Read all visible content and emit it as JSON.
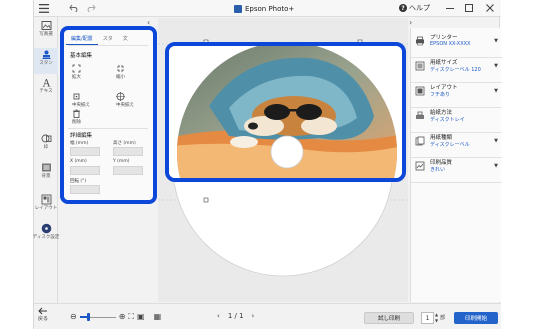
{
  "titlebar": {
    "title": "Epson Photo+",
    "help_label": "ヘルプ",
    "menu_icon": "hamburger-icon",
    "undo_icon": "undo-icon",
    "redo_icon": "redo-icon"
  },
  "rail": {
    "items": [
      {
        "label": "写真選",
        "icon": "photo-select-icon"
      },
      {
        "label": "スタン",
        "icon": "stamp-icon"
      },
      {
        "label": "テキス",
        "icon": "text-icon"
      },
      {
        "label": "枠",
        "icon": "frame-icon"
      },
      {
        "label": "背景",
        "icon": "background-icon"
      },
      {
        "label": "レイアウト",
        "icon": "layout-settings-icon"
      },
      {
        "label": "ディスク設定",
        "icon": "disc-settings-icon"
      }
    ]
  },
  "edit_panel": {
    "tabs": [
      "編集/配置",
      "スタ",
      "文"
    ],
    "basic_title": "基本編集",
    "tools": [
      {
        "label": "拡大",
        "icon": "zoom-in-icon"
      },
      {
        "label": "縮小",
        "icon": "zoom-out-icon"
      },
      {
        "label": "中央揃え",
        "icon": "center-icon"
      },
      {
        "label": "中央揃え",
        "icon": "align-icon"
      },
      {
        "label": "削除",
        "icon": "delete-icon"
      }
    ],
    "detail_title": "詳細編集",
    "fields": {
      "width": "幅 (mm)",
      "height": "高さ (mm)",
      "x": "X (mm)",
      "y": "Y (mm)",
      "rotate": "回転 (°)"
    }
  },
  "settings": [
    {
      "title": "プリンター",
      "value": "EPSON XX-XXXX",
      "icon": "printer-icon"
    },
    {
      "title": "用紙サイズ",
      "value": "ディスクレーベル 120",
      "icon": "paper-size-icon"
    },
    {
      "title": "レイアウト",
      "value": "フチあり",
      "icon": "layout-icon"
    },
    {
      "title": "給紙方法",
      "value": "ディスクトレイ",
      "icon": "paper-feed-icon"
    },
    {
      "title": "用紙種類",
      "value": "ディスクレーベル",
      "icon": "paper-type-icon"
    },
    {
      "title": "印刷品質",
      "value": "きれい",
      "icon": "print-quality-icon"
    }
  ],
  "bottom": {
    "back_label": "戻る",
    "zoom_level": 0.25,
    "page": "1 / 1",
    "preview_label": "試し印刷",
    "copies": "1",
    "copies_unit": "部",
    "print_label": "印刷開始"
  },
  "colors": {
    "accent": "#1b57c6",
    "highlight_border": "#0d47d9",
    "print_button": "#2463c9"
  }
}
